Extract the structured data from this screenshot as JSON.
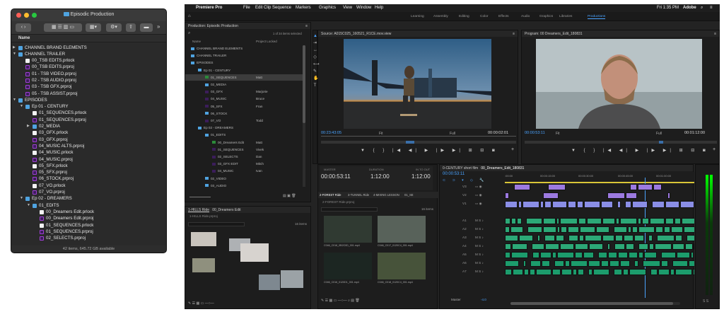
{
  "finder": {
    "title": "Episodic Production",
    "column_header": "Name",
    "status": "42 items, 645.72 GB available",
    "rows": [
      {
        "label": "CHANNEL BRAND ELEMENTS",
        "indent": 0,
        "type": "folder",
        "arrow": "right"
      },
      {
        "label": "CHANNEL TRAILER",
        "indent": 0,
        "type": "folder",
        "arrow": "down"
      },
      {
        "label": "00_TSB EDITS.prlock",
        "indent": 1,
        "type": "file"
      },
      {
        "label": "00_TSB EDITS.prproj",
        "indent": 1,
        "type": "proj"
      },
      {
        "label": "01 - TSB VIDEO.prproj",
        "indent": 1,
        "type": "proj"
      },
      {
        "label": "02 - TSB AUDIO.prproj",
        "indent": 1,
        "type": "proj"
      },
      {
        "label": "03 - TSB GFX.prproj",
        "indent": 1,
        "type": "proj"
      },
      {
        "label": "05 - TSB ASSIST.prproj",
        "indent": 1,
        "type": "proj"
      },
      {
        "label": "EPISODES",
        "indent": 0,
        "type": "folder",
        "arrow": "down"
      },
      {
        "label": "Ep 01 - CENTURY",
        "indent": 1,
        "type": "folder",
        "arrow": "down"
      },
      {
        "label": "01_SEQUENCES.prlock",
        "indent": 2,
        "type": "file"
      },
      {
        "label": "01_SEQUENCES.prproj",
        "indent": 2,
        "type": "proj"
      },
      {
        "label": "02_MEDIA",
        "indent": 2,
        "type": "folder",
        "arrow": "right"
      },
      {
        "label": "03_GFX.prlock",
        "indent": 2,
        "type": "file"
      },
      {
        "label": "03_GFX.prproj",
        "indent": 2,
        "type": "proj"
      },
      {
        "label": "04_MUSIC ALTS.prproj",
        "indent": 2,
        "type": "proj"
      },
      {
        "label": "04_MUSIC.prlock",
        "indent": 2,
        "type": "file"
      },
      {
        "label": "04_MUSIC.prproj",
        "indent": 2,
        "type": "proj"
      },
      {
        "label": "05_SFX.prlock",
        "indent": 2,
        "type": "file"
      },
      {
        "label": "05_SFX.prproj",
        "indent": 2,
        "type": "proj"
      },
      {
        "label": "06_STOCK.prproj",
        "indent": 2,
        "type": "proj"
      },
      {
        "label": "07_VO.prlock",
        "indent": 2,
        "type": "file"
      },
      {
        "label": "07_VO.prproj",
        "indent": 2,
        "type": "proj"
      },
      {
        "label": "Ep 02 - DREAMERS",
        "indent": 1,
        "type": "folder",
        "arrow": "down"
      },
      {
        "label": "01_EDITS",
        "indent": 2,
        "type": "folder",
        "arrow": "down"
      },
      {
        "label": "00_Dreamers Edit.prlock",
        "indent": 3,
        "type": "file"
      },
      {
        "label": "00_Dreamers Edit.prproj",
        "indent": 3,
        "type": "proj"
      },
      {
        "label": "01_SEQUENCES.prlock",
        "indent": 3,
        "type": "file"
      },
      {
        "label": "01_SEQUENCES.prproj",
        "indent": 3,
        "type": "proj"
      },
      {
        "label": "02_SELECTS.prproj",
        "indent": 3,
        "type": "proj"
      }
    ]
  },
  "premiere": {
    "app": "Premiere Pro",
    "menu": [
      "File",
      "Edit",
      "Clip",
      "Sequence",
      "Markers",
      "Graphics",
      "View",
      "Window",
      "Help"
    ],
    "status_right": [
      "Fri 1:35 PM",
      "Adobe"
    ],
    "workspaces": [
      "Learning",
      "Assembly",
      "Editing",
      "Color",
      "Effects",
      "Audio",
      "Graphics",
      "Libraries",
      "Productions"
    ],
    "active_workspace": "Productions",
    "production": {
      "title": "Production: Episodic Production",
      "selected": "1 of 34 items selected",
      "col_name": "Name",
      "col_lock": "Project Locked",
      "rows": [
        {
          "label": "CHANNEL BRAND ELEMENTS",
          "indent": 0,
          "lock": ""
        },
        {
          "label": "CHANNEL TRAILER",
          "indent": 0,
          "lock": ""
        },
        {
          "label": "EPISODES",
          "indent": 0,
          "lock": ""
        },
        {
          "label": "Ep 01 - CENTURY",
          "indent": 1,
          "lock": ""
        },
        {
          "label": "01_SEQUENCES",
          "indent": 2,
          "lock": "Matt"
        },
        {
          "label": "02_MEDIA",
          "indent": 2,
          "lock": ""
        },
        {
          "label": "03_GFX",
          "indent": 2,
          "lock": "Marjorie"
        },
        {
          "label": "04_MUSIC",
          "indent": 2,
          "lock": "Bruce"
        },
        {
          "label": "05_SFX",
          "indent": 2,
          "lock": "Fran"
        },
        {
          "label": "06_STOCK",
          "indent": 2,
          "lock": ""
        },
        {
          "label": "07_VO",
          "indent": 2,
          "lock": "Todd"
        },
        {
          "label": "Ep 02 - DREAMERS",
          "indent": 1,
          "lock": ""
        },
        {
          "label": "01_EDITS",
          "indent": 2,
          "lock": ""
        },
        {
          "label": "00_Dreamers Edit",
          "indent": 3,
          "lock": "Matt"
        },
        {
          "label": "01_SEQUENCES",
          "indent": 3,
          "lock": "Vivek"
        },
        {
          "label": "02_SELECTS",
          "indent": 3,
          "lock": "Dan"
        },
        {
          "label": "03_GFX EDIT",
          "indent": 3,
          "lock": "Mitch"
        },
        {
          "label": "04_MUSIC",
          "indent": 3,
          "lock": "Ivan"
        },
        {
          "label": "02_VIDEO",
          "indent": 2,
          "lock": ""
        },
        {
          "label": "03_AUDIO",
          "indent": 2,
          "lock": ""
        }
      ]
    },
    "source": {
      "title": "Source: A015C025_160521_R1CE.mov.view",
      "tc_left": "00:23:43:05",
      "fit": "Fit",
      "full": "Full",
      "tc_right": "00:00:02:01"
    },
    "program": {
      "title": "Program: 00 Dreamers_Edit_180831",
      "tc_left": "00:00:53:11",
      "fit": "Fit",
      "full": "Full",
      "tc_right": "00:01:12:00"
    },
    "hills": {
      "tab1": "1-HILLS Ride",
      "tab2": "00_Dreamers Edit",
      "path": "1-HILLS Ride.prproj",
      "count": "16 items"
    },
    "meta": {
      "master_label": "MASTER",
      "master": "00:00:53:11",
      "duration_label": "DURATION",
      "duration": "1:12:00",
      "inout_label": "IN TO OUT",
      "inout": "1:12:00"
    },
    "bin_tabs": [
      "2-FOREST Ride",
      "3-TUNNEL Ride",
      "4-MIXING LESSON",
      "01_SE"
    ],
    "forest": {
      "path": "2-FOREST Ride.prproj",
      "count": "16 items",
      "clips": [
        "C046_C018_0B2C0D_001.mp4",
        "C046_C017_0120C4_001.mp4",
        "C046_C016_0120D1_001.mp4",
        "C046_C018_0120C4_001.mp4"
      ]
    },
    "timeline": {
      "tab1": "0-CENTURY short film",
      "tab2": "00_Dreamers_Edit_180831",
      "tc": "00:00:53:11",
      "ruler": [
        ":00:00",
        "00:00:15:00",
        "00:00:30:00",
        "00:00:45:00",
        "00:01:00:00"
      ],
      "tracks": [
        "V3",
        "V2",
        "V1",
        "A1",
        "A2",
        "A3",
        "A4",
        "A5",
        "A6",
        "A7"
      ],
      "master": "Master",
      "master_val": "-4.0"
    },
    "colors": {
      "accent": "#4aa3ff",
      "project": "#a03fd6",
      "selected_row": "#3c3c3c"
    }
  }
}
